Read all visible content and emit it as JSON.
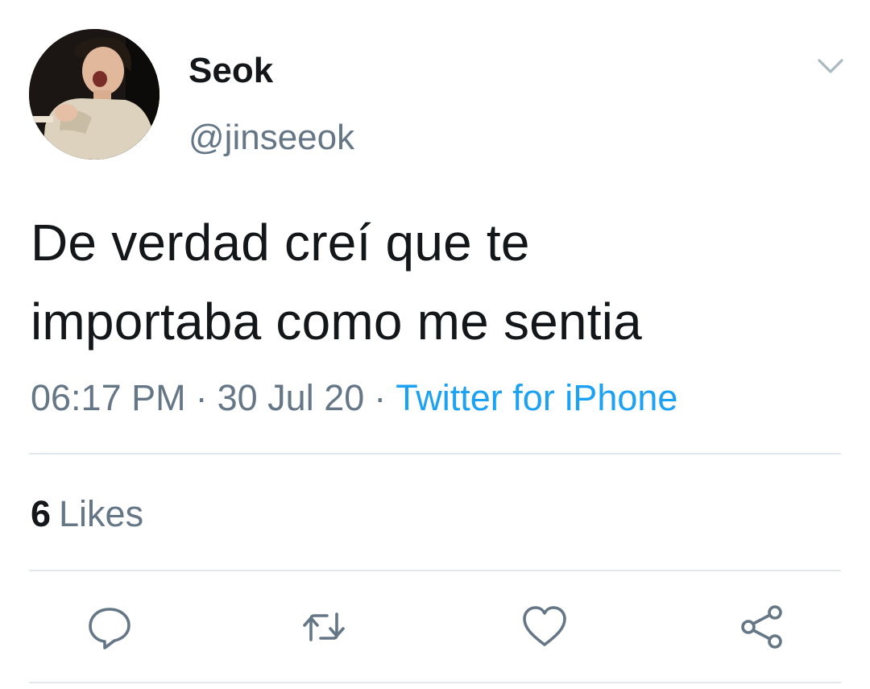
{
  "tweet": {
    "display_name": "Seok",
    "handle": "@jinseeok",
    "text_line_1": "De verdad creí que te",
    "text_line_2": "importaba como me sentia",
    "time": "06:17 PM",
    "separator": "·",
    "date": "30 Jul 20",
    "source": "Twitter for iPhone",
    "likes_count": "6",
    "likes_label": "Likes"
  },
  "icons": {
    "avatar": "profile-photo",
    "more": "chevron-down-icon",
    "reply": "reply-icon",
    "retweet": "retweet-icon",
    "like": "heart-icon",
    "share": "share-icon"
  },
  "colors": {
    "text": "#14171a",
    "secondary": "#657786",
    "link": "#1da1f2",
    "divider": "#e1e8ed",
    "action_icon": "#657786"
  }
}
